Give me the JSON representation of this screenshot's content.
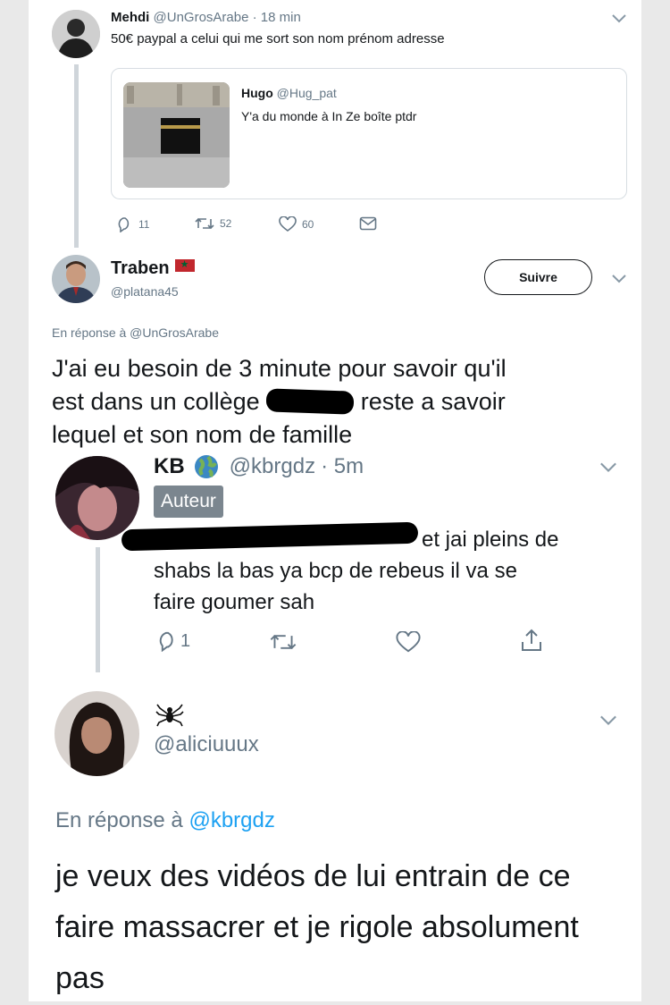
{
  "tweet1": {
    "name": "Mehdi",
    "handle": "@UnGrosArabe",
    "time": "· 18 min",
    "text": "50€ paypal a celui qui me sort son nom prénom adresse",
    "quote": {
      "name": "Hugo",
      "handle": "@Hug_pat",
      "text": "Y'a du monde à In Ze boîte ptdr"
    },
    "replies": "11",
    "retweets": "52",
    "likes": "60"
  },
  "tweet2": {
    "name": "Traben",
    "handle": "@platana45",
    "follow_label": "Suivre",
    "reply_to": "En réponse à @UnGrosArabe",
    "text_line1": "J'ai eu besoin de 3 minute pour savoir qu'il",
    "text_line2a": "est dans un collège",
    "text_line2b": "reste a savoir",
    "text_line3": "lequel et son nom de famille"
  },
  "tweet3": {
    "name": "KB",
    "handle": "@kbrgdz",
    "time": "· 5m",
    "badge": "Auteur",
    "text_line1": "et jai pleins de",
    "text_line2": "shabs la bas ya bcp de rebeus il va se",
    "text_line3": "faire goumer sah",
    "replies": "1"
  },
  "tweet4": {
    "name_icon": "spider-icon",
    "handle": "@aliciuuux",
    "reply_to_prefix": "En réponse à",
    "reply_to_handle": "@kbrgdz",
    "text_line1": "je veux des vidéos de lui entrain de ce",
    "text_line2": "faire massacrer et je rigole absolument",
    "text_line3": "pas"
  },
  "colors": {
    "text": "#14171a",
    "secondary": "#657786",
    "link": "#1da1f2",
    "badge": "#7b868f"
  }
}
